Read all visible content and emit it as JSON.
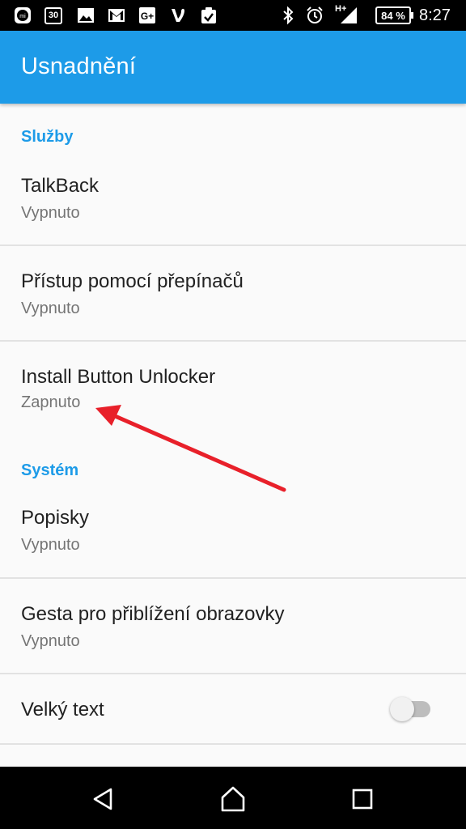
{
  "status_bar": {
    "icons": [
      "mi-icon",
      "calendar-icon",
      "image-icon",
      "gmail-icon",
      "google-plus-icon",
      "vine-icon",
      "clipboard-check-icon",
      "bluetooth-icon",
      "alarm-icon",
      "signal-icon"
    ],
    "calendar_day": "30",
    "network_type": "H+",
    "battery_label": "84 %",
    "time": "8:27"
  },
  "app_bar": {
    "title": "Usnadnění"
  },
  "sections": [
    {
      "header": "Služby",
      "items": [
        {
          "title": "TalkBack",
          "subtitle": "Vypnuto"
        },
        {
          "title": "Přístup pomocí přepínačů",
          "subtitle": "Vypnuto"
        },
        {
          "title": "Install Button Unlocker",
          "subtitle": "Zapnuto"
        }
      ]
    },
    {
      "header": "Systém",
      "items": [
        {
          "title": "Popisky",
          "subtitle": "Vypnuto"
        },
        {
          "title": "Gesta pro přiblížení obrazovky",
          "subtitle": "Vypnuto"
        },
        {
          "title": "Velký text",
          "toggle": false
        }
      ]
    }
  ],
  "colors": {
    "accent": "#1d9be8",
    "annotation_arrow": "#e8202a"
  },
  "nav_bar": {
    "icons": [
      "back-icon",
      "home-icon",
      "recents-icon"
    ]
  }
}
